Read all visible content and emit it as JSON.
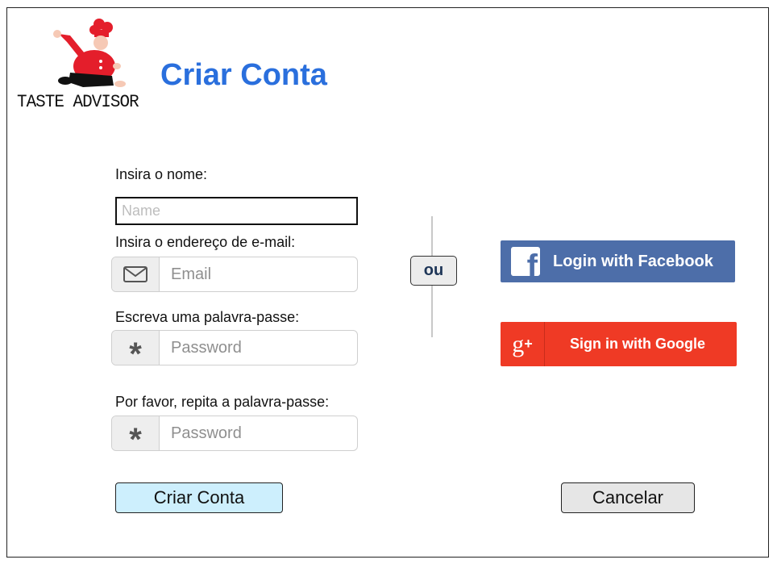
{
  "brand": {
    "name": "TASTE ADVISOR"
  },
  "page": {
    "title": "Criar Conta"
  },
  "form": {
    "name_label": "Insira o nome:",
    "name_placeholder": "Name",
    "email_label": "Insira o endereço de e-mail:",
    "email_placeholder": "Email",
    "password_label": "Escreva uma palavra-passe:",
    "password_placeholder": "Password",
    "repeat_label": "Por favor, repita a palavra-passe:",
    "repeat_placeholder": "Password"
  },
  "separator": {
    "text": "ou"
  },
  "social": {
    "facebook_label": "Login with Facebook",
    "facebook_icon": "f",
    "facebook_color": "#4d6ea9",
    "google_label": "Sign in with Google",
    "google_icon": "g",
    "google_icon_plus": "+",
    "google_color": "#ef3a25"
  },
  "actions": {
    "create_label": "Criar Conta",
    "cancel_label": "Cancelar"
  },
  "colors": {
    "title": "#2a6fdd",
    "primary_button": "#cdeffd",
    "cancel_button": "#e6e6e6"
  }
}
